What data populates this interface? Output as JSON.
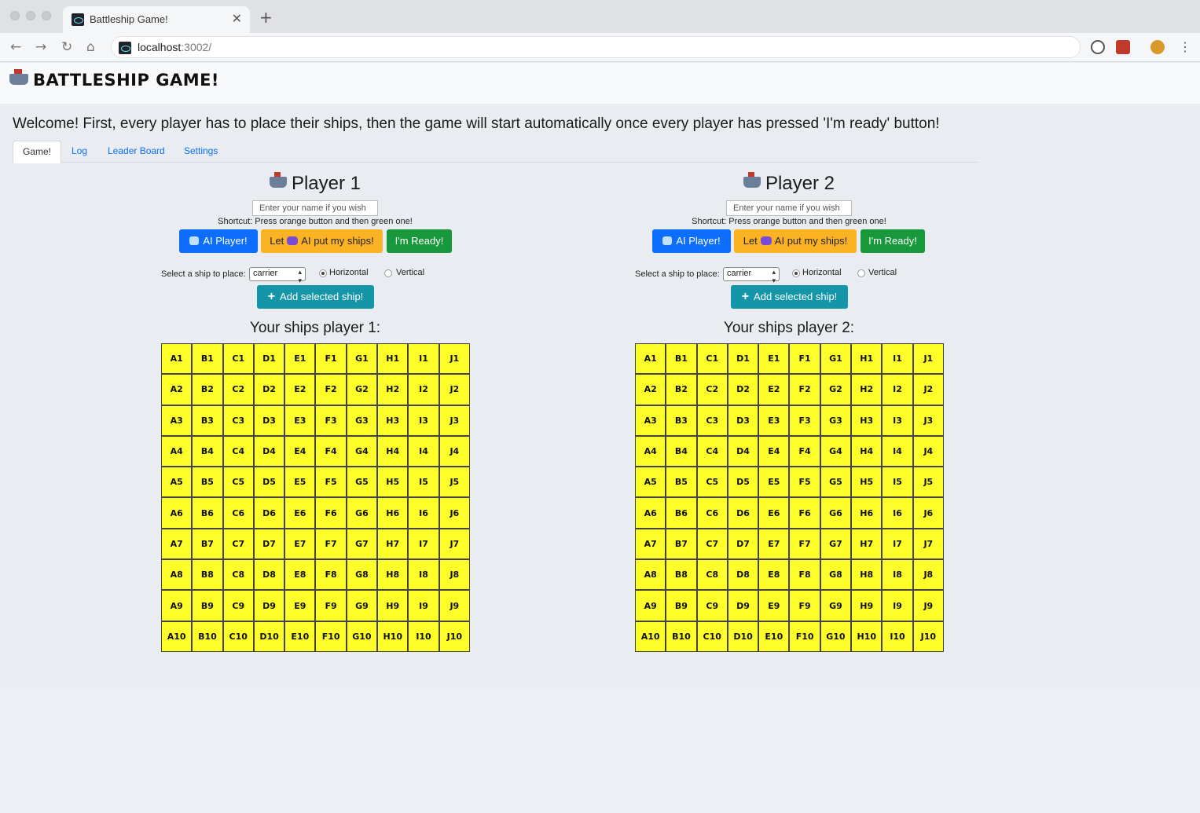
{
  "browser": {
    "tab_title": "Battleship Game!",
    "url_host": "localhost",
    "url_port": ":3002/"
  },
  "header": {
    "brand": "BATTLESHIP GAME!"
  },
  "welcome": "Welcome! First, every player has to place their ships, then the game will start automatically once every player has pressed 'I'm ready' button!",
  "tabs": [
    {
      "label": "Game!",
      "active": true
    },
    {
      "label": "Log",
      "active": false
    },
    {
      "label": "Leader Board",
      "active": false
    },
    {
      "label": "Settings",
      "active": false
    }
  ],
  "players": [
    {
      "title": "Player 1",
      "name_placeholder": "Enter your name if you wish",
      "shortcut": "Shortcut: Press orange button and then green one!",
      "ai_button": "AI Player!",
      "ai_place_pre": "Let",
      "ai_place_post": "AI put my ships!",
      "ready_button": "I'm Ready!",
      "select_label": "Select a ship to place:",
      "selected_ship": "carrier",
      "horizontal_label": "Horizontal",
      "vertical_label": "Vertical",
      "orientation": "horizontal",
      "add_button": "Add selected ship!",
      "ships_heading": "Your ships player 1:"
    },
    {
      "title": "Player 2",
      "name_placeholder": "Enter your name if you wish",
      "shortcut": "Shortcut: Press orange button and then green one!",
      "ai_button": "AI Player!",
      "ai_place_pre": "Let",
      "ai_place_post": "AI put my ships!",
      "ready_button": "I'm Ready!",
      "select_label": "Select a ship to place:",
      "selected_ship": "carrier",
      "horizontal_label": "Horizontal",
      "vertical_label": "Vertical",
      "orientation": "horizontal",
      "add_button": "Add selected ship!",
      "ships_heading": "Your ships player 2:"
    }
  ],
  "grid": {
    "columns": [
      "A",
      "B",
      "C",
      "D",
      "E",
      "F",
      "G",
      "H",
      "I",
      "J"
    ],
    "rows": [
      1,
      2,
      3,
      4,
      5,
      6,
      7,
      8,
      9,
      10
    ],
    "cell_color": "#fdfd2a"
  },
  "icons": [
    "ship-icon",
    "robot-icon",
    "alien-icon",
    "plus-icon",
    "back-icon",
    "forward-icon",
    "reload-icon",
    "home-icon",
    "close-icon"
  ]
}
